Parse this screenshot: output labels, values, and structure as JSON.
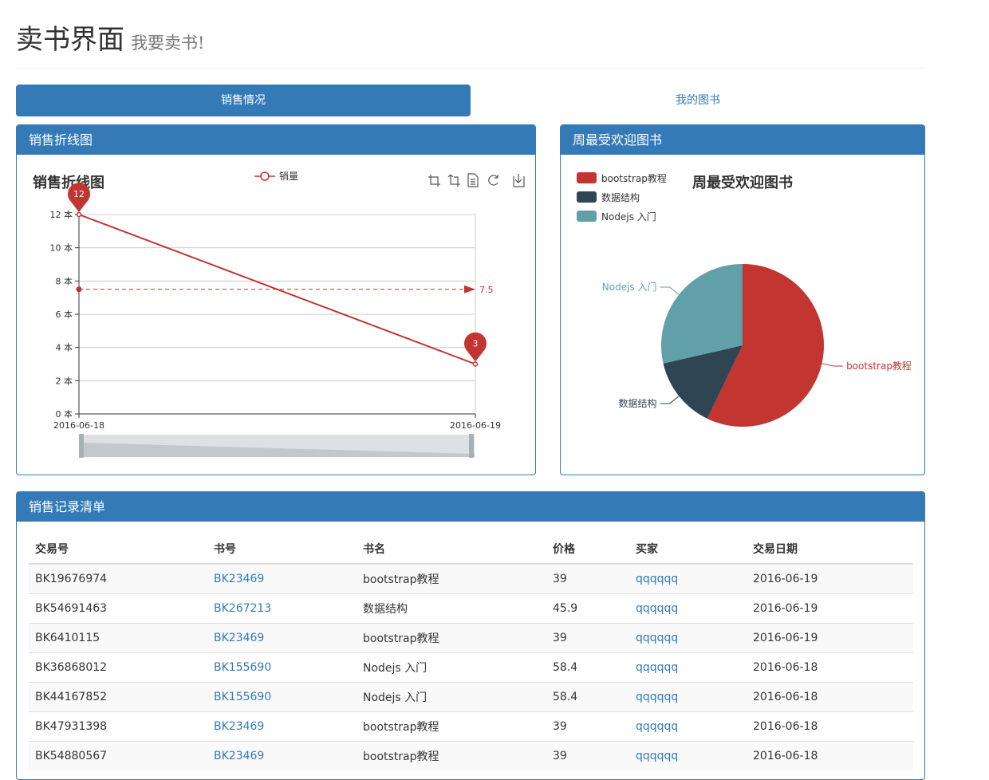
{
  "header": {
    "title": "卖书界面",
    "subtitle": "我要卖书!"
  },
  "tabs": [
    {
      "label": "销售情况",
      "active": true
    },
    {
      "label": "我的图书",
      "active": false
    }
  ],
  "line_panel": {
    "heading": "销售折线图"
  },
  "pie_panel": {
    "heading": "周最受欢迎图书"
  },
  "table_panel": {
    "heading": "销售记录清单"
  },
  "toolbox_icons": [
    "zoom-icon",
    "zoom-reset-icon",
    "data-view-icon",
    "restore-icon",
    "save-image-icon"
  ],
  "colors": {
    "primary": "#337ab7",
    "red": "#c23531",
    "navy": "#2f4554",
    "teal": "#61a0a8"
  },
  "chart_data": [
    {
      "type": "line",
      "title": "销售折线图",
      "legend": [
        "销量"
      ],
      "categories": [
        "2016-06-18",
        "2016-06-19"
      ],
      "series": [
        {
          "name": "销量",
          "values": [
            12,
            3
          ]
        }
      ],
      "yticks": [
        "0 本",
        "2 本",
        "4 本",
        "6 本",
        "8 本",
        "10 本",
        "12 本"
      ],
      "ylim": [
        0,
        12
      ],
      "markpoints": [
        "12",
        "3"
      ],
      "markline": {
        "label": "7.5",
        "value": 7.5
      },
      "grid": true
    },
    {
      "type": "pie",
      "title": "周最受欢迎图书",
      "legend": [
        "bootstrap教程",
        "数据结构",
        "Nodejs 入门"
      ],
      "labels": [
        "bootstrap教程",
        "数据结构",
        "Nodejs 入门"
      ],
      "values": [
        4,
        1,
        2
      ],
      "colors": [
        "#c23531",
        "#2f4554",
        "#61a0a8"
      ]
    }
  ],
  "table": {
    "headers": [
      "交易号",
      "书号",
      "书名",
      "价格",
      "买家",
      "交易日期"
    ],
    "rows": [
      [
        "BK19676974",
        "BK23469",
        "bootstrap教程",
        "39",
        "qqqqqq",
        "2016-06-19"
      ],
      [
        "BK54691463",
        "BK267213",
        "数据结构",
        "45.9",
        "qqqqqq",
        "2016-06-19"
      ],
      [
        "BK6410115",
        "BK23469",
        "bootstrap教程",
        "39",
        "qqqqqq",
        "2016-06-19"
      ],
      [
        "BK36868012",
        "BK155690",
        "Nodejs 入门",
        "58.4",
        "qqqqqq",
        "2016-06-18"
      ],
      [
        "BK44167852",
        "BK155690",
        "Nodejs 入门",
        "58.4",
        "qqqqqq",
        "2016-06-18"
      ],
      [
        "BK47931398",
        "BK23469",
        "bootstrap教程",
        "39",
        "qqqqqq",
        "2016-06-18"
      ],
      [
        "BK54880567",
        "BK23469",
        "bootstrap教程",
        "39",
        "qqqqqq",
        "2016-06-18"
      ]
    ]
  }
}
